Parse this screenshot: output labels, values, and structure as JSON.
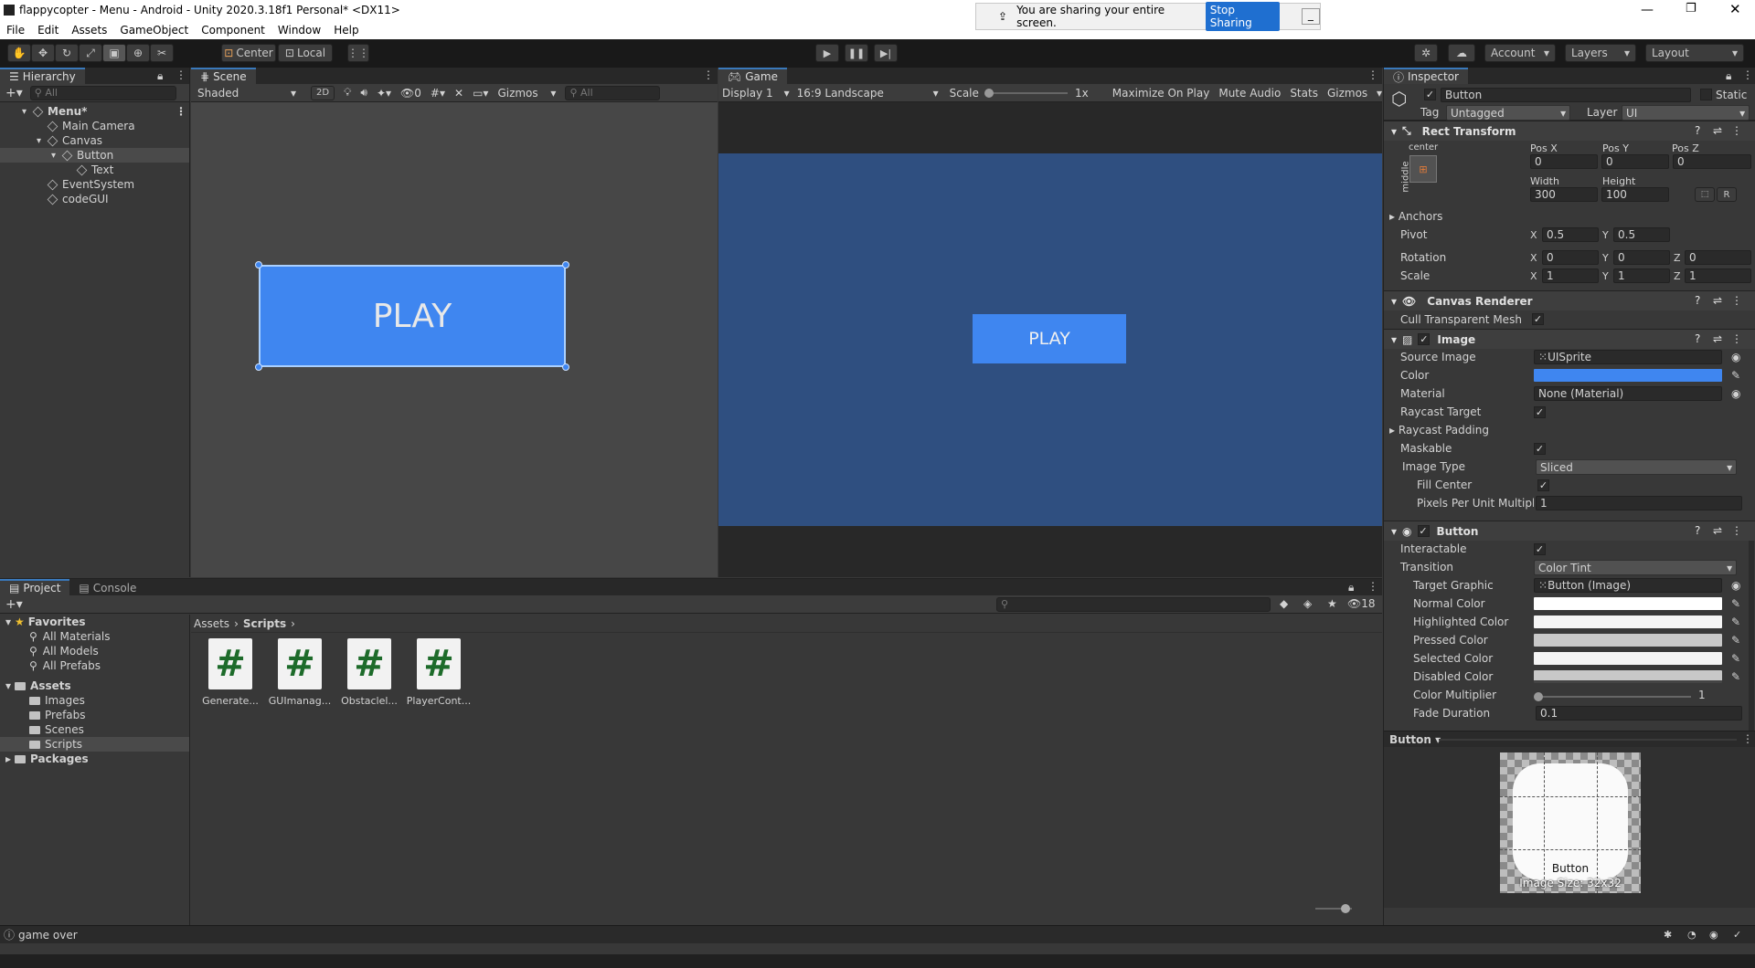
{
  "title": "flappycopter - Menu - Android - Unity 2020.3.18f1 Personal* <DX11>",
  "menu": [
    "File",
    "Edit",
    "Assets",
    "GameObject",
    "Component",
    "Window",
    "Help"
  ],
  "share": {
    "text": "You are sharing your entire screen.",
    "stop": "Stop Sharing"
  },
  "toolbar": {
    "center": "Center",
    "local": "Local",
    "account": "Account",
    "layers": "Layers",
    "layout": "Layout"
  },
  "hierarchy": {
    "tab": "Hierarchy",
    "search": "All",
    "items": [
      {
        "label": "Menu*",
        "depth": 0
      },
      {
        "label": "Main Camera",
        "depth": 1
      },
      {
        "label": "Canvas",
        "depth": 1
      },
      {
        "label": "Button",
        "depth": 2
      },
      {
        "label": "Text",
        "depth": 3
      },
      {
        "label": "EventSystem",
        "depth": 1
      },
      {
        "label": "codeGUI",
        "depth": 1
      }
    ]
  },
  "scene": {
    "tab": "Scene",
    "shading": "Shaded",
    "mode2d": "2D",
    "hidden_count": "0",
    "gizmos": "Gizmos",
    "search": "All",
    "button_text": "PLAY"
  },
  "game": {
    "tab": "Game",
    "display": "Display 1",
    "aspect": "16:9 Landscape",
    "scale_label": "Scale",
    "scale_value": "1x",
    "maximize": "Maximize On Play",
    "mute": "Mute Audio",
    "stats": "Stats",
    "gizmos": "Gizmos",
    "button_text": "PLAY"
  },
  "project": {
    "tab": "Project",
    "console": "Console",
    "hidden_count": "18",
    "favorites": {
      "label": "Favorites",
      "items": [
        "All Materials",
        "All Models",
        "All Prefabs"
      ]
    },
    "assets": {
      "label": "Assets",
      "items": [
        "Images",
        "Prefabs",
        "Scenes",
        "Scripts"
      ]
    },
    "packages": "Packages",
    "breadcrumb": [
      "Assets",
      "Scripts"
    ],
    "files": [
      "Generate...",
      "GUImanag...",
      "Obstaclel...",
      "PlayerCont..."
    ]
  },
  "inspector": {
    "tab": "Inspector",
    "name": "Button",
    "static": "Static",
    "tag_label": "Tag",
    "tag": "Untagged",
    "layer_label": "Layer",
    "layer": "UI",
    "rect": {
      "title": "Rect Transform",
      "anchor_h": "center",
      "anchor_v": "middle",
      "posx_l": "Pos X",
      "posy_l": "Pos Y",
      "posz_l": "Pos Z",
      "posx": "0",
      "posy": "0",
      "posz": "0",
      "w_l": "Width",
      "h_l": "Height",
      "w": "300",
      "h": "100",
      "r": "R",
      "anchors": "Anchors",
      "pivot": "Pivot",
      "pivot_x": "0.5",
      "pivot_y": "0.5",
      "rotation": "Rotation",
      "rot_x": "0",
      "rot_y": "0",
      "rot_z": "0",
      "scale": "Scale",
      "sc_x": "1",
      "sc_y": "1",
      "sc_z": "1",
      "x": "X",
      "y": "Y",
      "z": "Z"
    },
    "canvas_renderer": {
      "title": "Canvas Renderer",
      "cull": "Cull Transparent Mesh"
    },
    "image": {
      "title": "Image",
      "source_l": "Source Image",
      "source": "UISprite",
      "color_l": "Color",
      "material_l": "Material",
      "material": "None (Material)",
      "raycast": "Raycast Target",
      "padding": "Raycast Padding",
      "maskable": "Maskable",
      "type_l": "Image Type",
      "type": "Sliced",
      "fill": "Fill Center",
      "ppu_l": "Pixels Per Unit Multiplie",
      "ppu": "1"
    },
    "button": {
      "title": "Button",
      "interactable": "Interactable",
      "transition_l": "Transition",
      "transition": "Color Tint",
      "target_l": "Target Graphic",
      "target": "Button (Image)",
      "normal": "Normal Color",
      "highlighted": "Highlighted Color",
      "pressed": "Pressed Color",
      "selected": "Selected Color",
      "disabled": "Disabled Color",
      "multiplier": "Color Multiplier",
      "multiplier_v": "1",
      "fade": "Fade Duration",
      "fade_v": "0.1"
    },
    "preview": {
      "label": "Button",
      "caption": "Button",
      "size": "Image Size: 32x32"
    }
  },
  "status": "game over",
  "colors": {
    "accent": "#3a79bb",
    "button_blue": "#3f86f0",
    "game_bg": "#2f4f80",
    "normal": "#ffffff",
    "pressed": "#c8c8c8",
    "disabled": "#c8c8c8"
  }
}
